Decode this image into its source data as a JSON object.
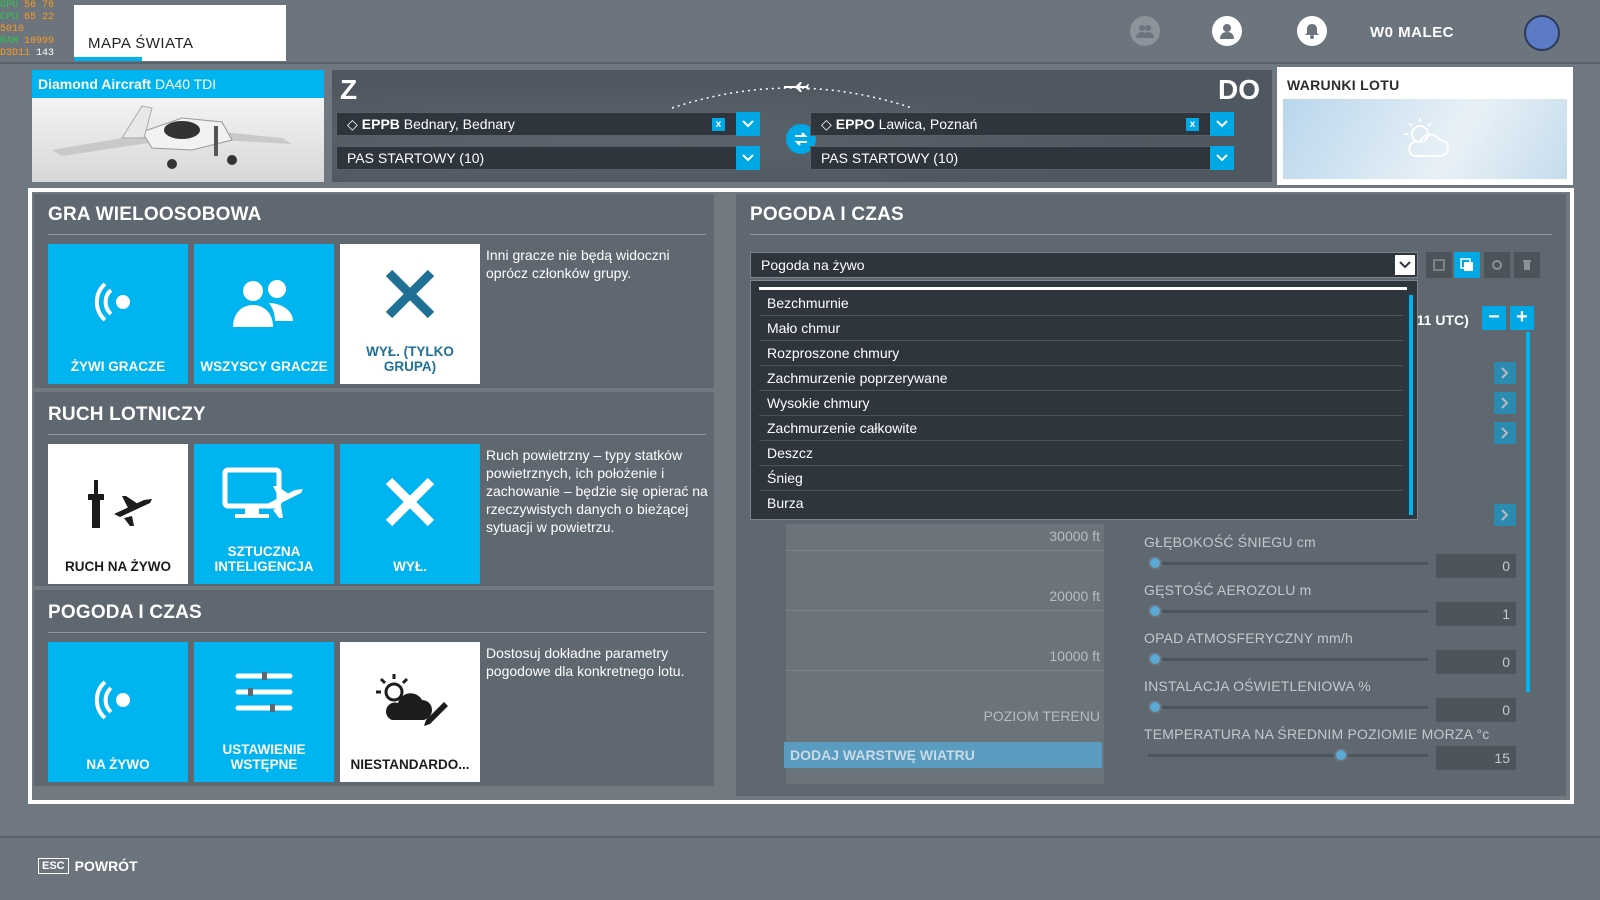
{
  "perf": {
    "gpu_label": "GPU",
    "gpu_temp": "56",
    "gpu_load": "76",
    "cpu_label": "CPU",
    "cpu_temp": "65",
    "cpu_load": "22",
    "cpu_mhz": "5010",
    "ram_label": "RAM",
    "ram_value": "10999",
    "d3d_label": "D3D11",
    "fps": "143"
  },
  "topbar": {
    "world_map_tab": "MAPA ŚWIATA",
    "username": "W0 MALEC"
  },
  "aircraft": {
    "brand": "Diamond Aircraft",
    "model": "DA40 TDI"
  },
  "route": {
    "from_label": "Z",
    "to_label": "DO",
    "from_code": "EPPB",
    "from_name": "Bednary, Bednary",
    "to_code": "EPPO",
    "to_name": "Lawica, Poznań",
    "from_runway": "PAS STARTOWY (10)",
    "to_runway": "PAS STARTOWY (10)",
    "clear_glyph": "x"
  },
  "conditions": {
    "title": "WARUNKI LOTU"
  },
  "multiplayer": {
    "title": "GRA WIELOOSOBOWA",
    "tiles": [
      "ŻYWI GRACZE",
      "WSZYSCY GRACZE",
      "WYŁ. (TYLKO GRUPA)"
    ],
    "desc": "Inni gracze nie będą widoczni oprócz członków grupy."
  },
  "traffic": {
    "title": "RUCH LOTNICZY",
    "tiles": [
      "RUCH NA ŻYWO",
      "SZTUCZNA INTELIGENCJA",
      "WYŁ."
    ],
    "desc": "Ruch powietrzny – typy statków powietrznych, ich położenie i zachowanie – będzie się opierać na rzeczywistych danych o bieżącej sytuacji w powietrzu."
  },
  "weather_left": {
    "title": "POGODA I CZAS",
    "tiles": [
      "NA ŻYWO",
      "USTAWIENIE WSTĘPNE",
      "NIESTANDARDO..."
    ],
    "desc": "Dostosuj dokładne parametry pogodowe dla konkretnego lotu."
  },
  "weather_right": {
    "title": "POGODA I CZAS",
    "preset": "Pogoda na żywo",
    "options": [
      "Bezchmurnie",
      "Mało chmur",
      "Rozproszone chmury",
      "Zachmurzenie poprzerywane",
      "Wysokie chmury",
      "Zachmurzenie całkowite",
      "Deszcz",
      "Śnieg",
      "Burza"
    ],
    "utc": ":11 UTC)",
    "minus": "−",
    "plus": "+",
    "altitudes": [
      "30000 ft",
      "20000 ft",
      "10000 ft",
      "POZIOM TERENU"
    ],
    "add_wind": "DODAJ WARSTWĘ WIATRU",
    "params": [
      {
        "label": "GŁĘBOKOŚĆ ŚNIEGU cm",
        "value": "0",
        "level": 0.0
      },
      {
        "label": "GĘSTOŚĆ AEROZOLU m",
        "value": "1",
        "level": 0.0
      },
      {
        "label": "OPAD ATMOSFERYCZNY mm/h",
        "value": "0",
        "level": 0.0
      },
      {
        "label": "INSTALACJA OŚWIETLENIOWA %",
        "value": "0",
        "level": 0.0
      },
      {
        "label": "TEMPERATURA NA ŚREDNIM POZIOMIE MORZA °c",
        "value": "15",
        "level": 0.7
      }
    ]
  },
  "bottom": {
    "esc_key": "ESC",
    "back": "POWRÓT"
  },
  "colors": {
    "accent": "#00b4f0",
    "panel": "#5f6770",
    "background": "#6f7780"
  }
}
